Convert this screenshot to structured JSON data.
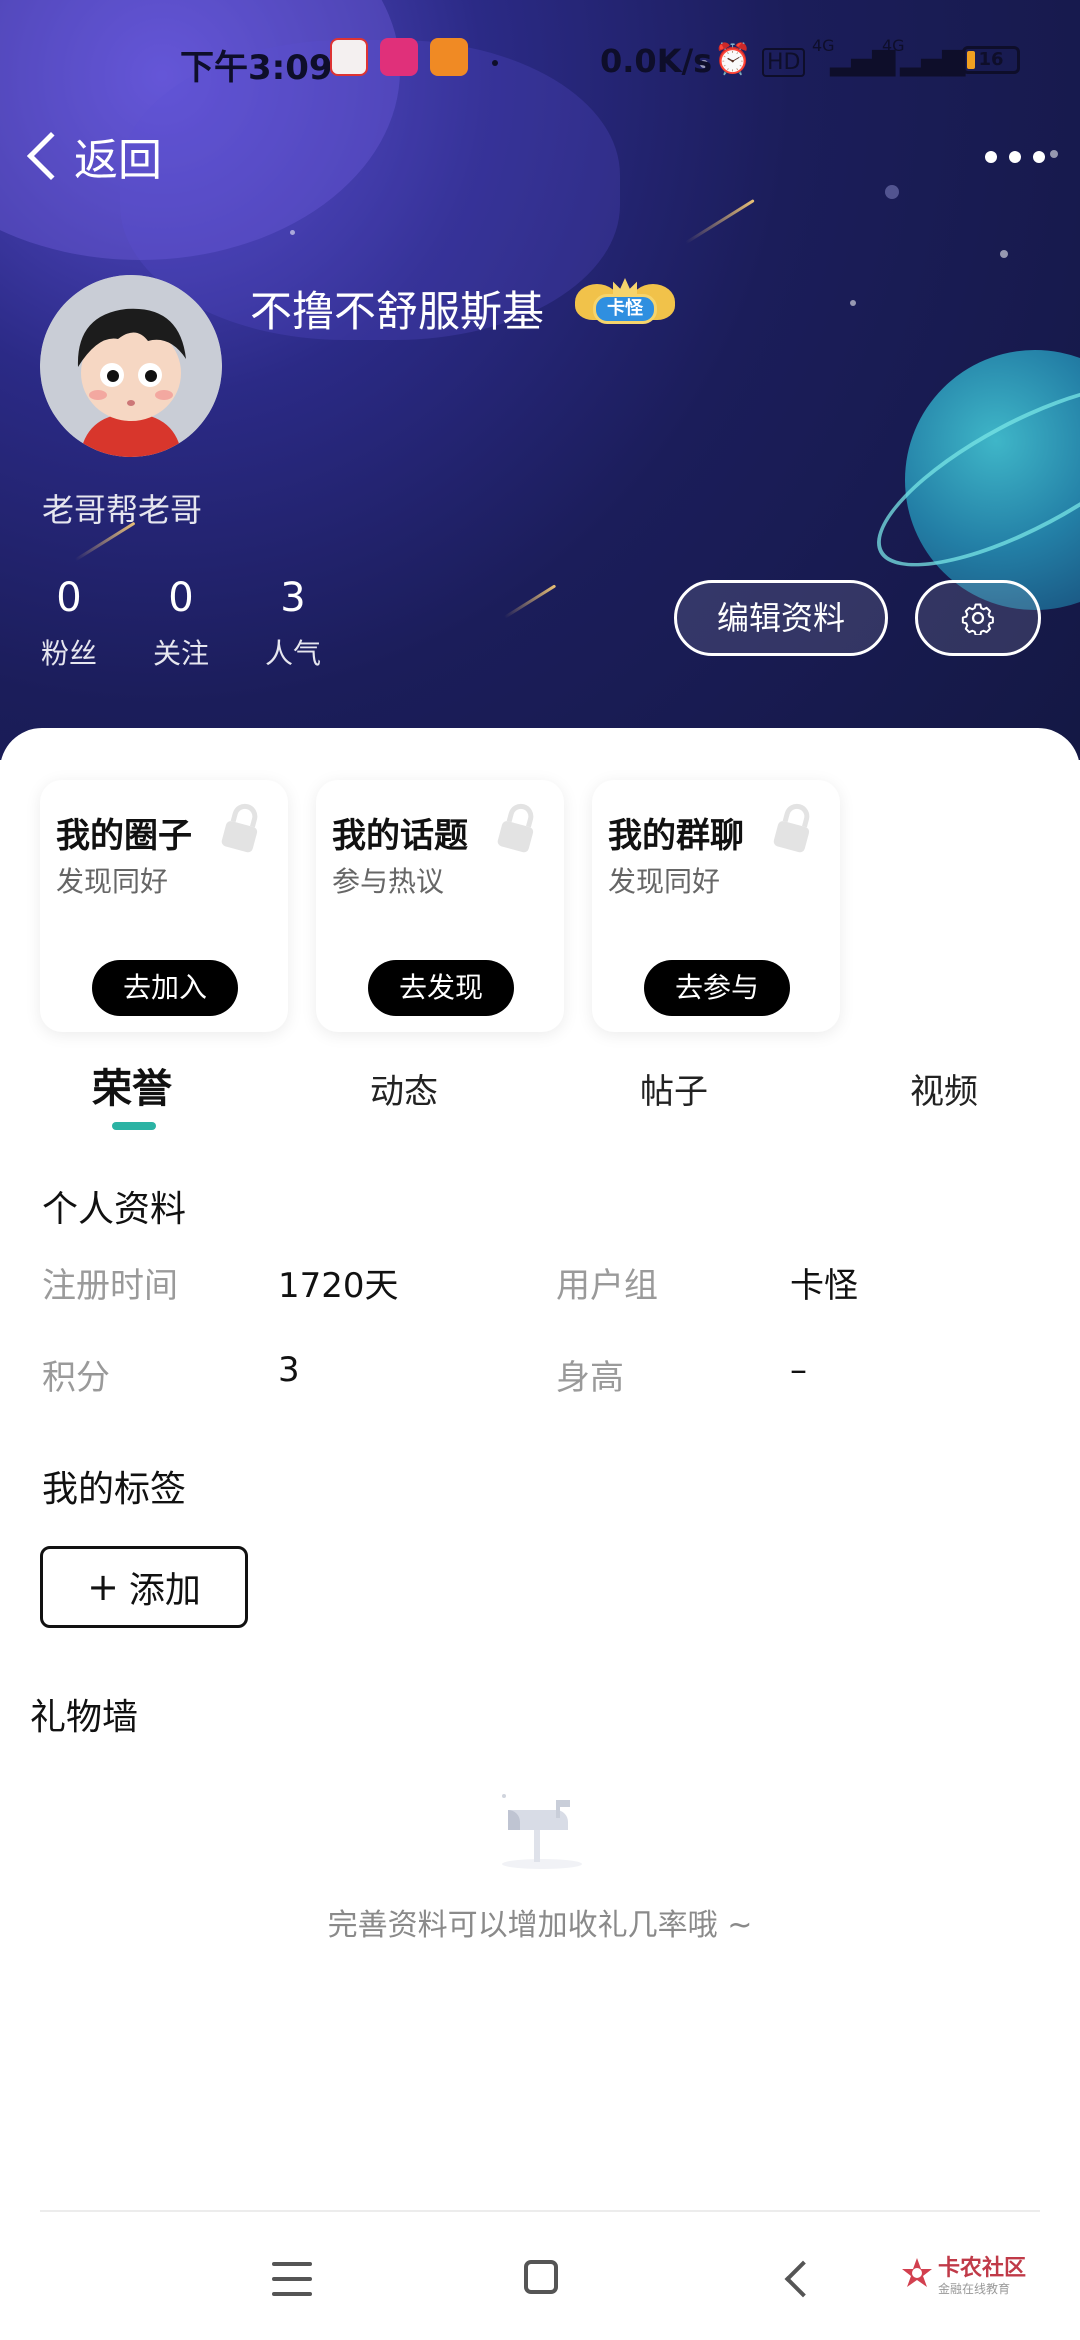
{
  "status_bar": {
    "time": "下午3:09",
    "network_speed": "0.0K/s",
    "signal_1": "4G",
    "signal_2": "4G",
    "battery": "16"
  },
  "nav": {
    "back_label": "返回"
  },
  "profile": {
    "username": "不撸不舒服斯基",
    "badge_text": "卡怪",
    "signature": "老哥帮老哥",
    "stats": [
      {
        "value": "0",
        "label": "粉丝"
      },
      {
        "value": "0",
        "label": "关注"
      },
      {
        "value": "3",
        "label": "人气"
      }
    ],
    "edit_button": "编辑资料"
  },
  "quick_cards": [
    {
      "title": "我的圈子",
      "subtitle": "发现同好",
      "button": "去加入"
    },
    {
      "title": "我的话题",
      "subtitle": "参与热议",
      "button": "去发现"
    },
    {
      "title": "我的群聊",
      "subtitle": "发现同好",
      "button": "去参与"
    }
  ],
  "tabs": [
    {
      "label": "荣誉",
      "active": true
    },
    {
      "label": "动态",
      "active": false
    },
    {
      "label": "帖子",
      "active": false
    },
    {
      "label": "视频",
      "active": false
    }
  ],
  "personal_info": {
    "title": "个人资料",
    "rows": [
      {
        "label1": "注册时间",
        "value1": "1720天",
        "label2": "用户组",
        "value2": "卡怪"
      },
      {
        "label1": "积分",
        "value1": "3",
        "label2": "身高",
        "value2": "–"
      }
    ]
  },
  "tags": {
    "title": "我的标签",
    "add_button": "添加"
  },
  "gift_wall": {
    "title": "礼物墙",
    "empty_hint": "完善资料可以增加收礼几率哦 ~"
  },
  "watermark": {
    "title": "卡农社区",
    "subtitle": "金融在线教育"
  },
  "colors": {
    "header_dark": "#1b1d5a",
    "accent_teal": "#2bb3a4",
    "button_black": "#000000"
  }
}
